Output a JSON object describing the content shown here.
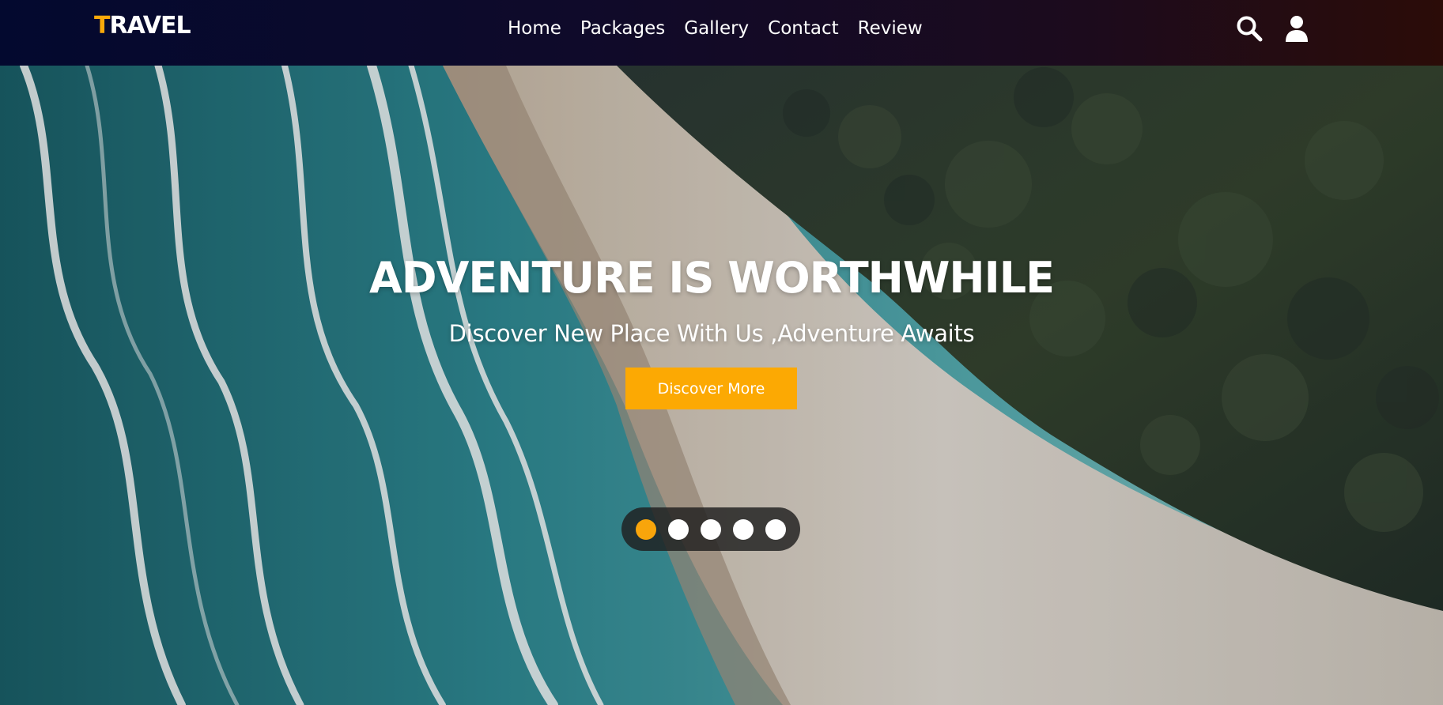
{
  "navbar": {
    "logo_first": "T",
    "logo_rest": "RAVEL",
    "links": [
      {
        "label": "Home"
      },
      {
        "label": "Packages"
      },
      {
        "label": "Gallery"
      },
      {
        "label": "Contact"
      },
      {
        "label": "Review"
      }
    ],
    "icons": [
      "search-icon",
      "user-icon"
    ]
  },
  "hero": {
    "title": "ADVENTURE IS WORTHWHILE",
    "subtitle": "Discover New Place With Us ,Adventure Awaits",
    "button_label": "Discover More",
    "slides": {
      "total": 5,
      "active_index": 0
    }
  },
  "colors": {
    "accent": "#fca903",
    "nav_gradient_start": "#03092f",
    "nav_gradient_end": "#2b0c08",
    "dot_inactive": "#ffffff"
  }
}
